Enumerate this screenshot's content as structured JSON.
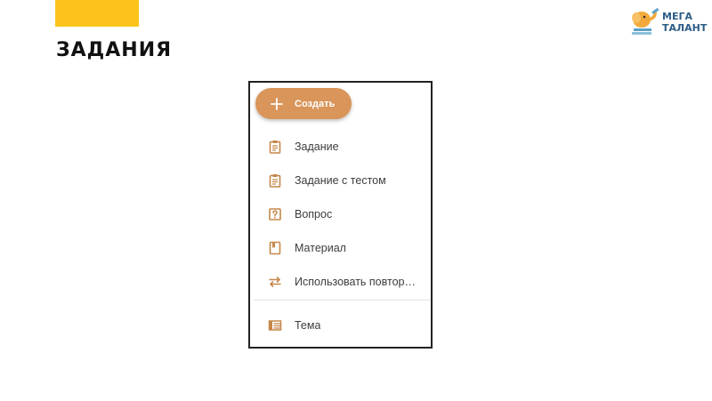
{
  "slide": {
    "title": "ЗАДАНИЯ"
  },
  "logo": {
    "line1": "МЕГА",
    "line2": "ТАЛАНТ",
    "icon": "elephant-icon"
  },
  "colors": {
    "accent_bar": "#fcc41a",
    "button": "#d9955a",
    "menu_icon": "#c5884a",
    "logo_text": "#2d5d86"
  },
  "create_button": {
    "label": "Создать",
    "icon": "plus-icon"
  },
  "menu": {
    "items": [
      {
        "label": "Задание",
        "icon": "assignment-icon"
      },
      {
        "label": "Задание с тестом",
        "icon": "quiz-assignment-icon"
      },
      {
        "label": "Вопрос",
        "icon": "question-icon"
      },
      {
        "label": "Материал",
        "icon": "material-icon"
      },
      {
        "label": "Использовать повтор…",
        "icon": "reuse-icon"
      }
    ],
    "topic": {
      "label": "Тема",
      "icon": "topic-icon"
    }
  }
}
